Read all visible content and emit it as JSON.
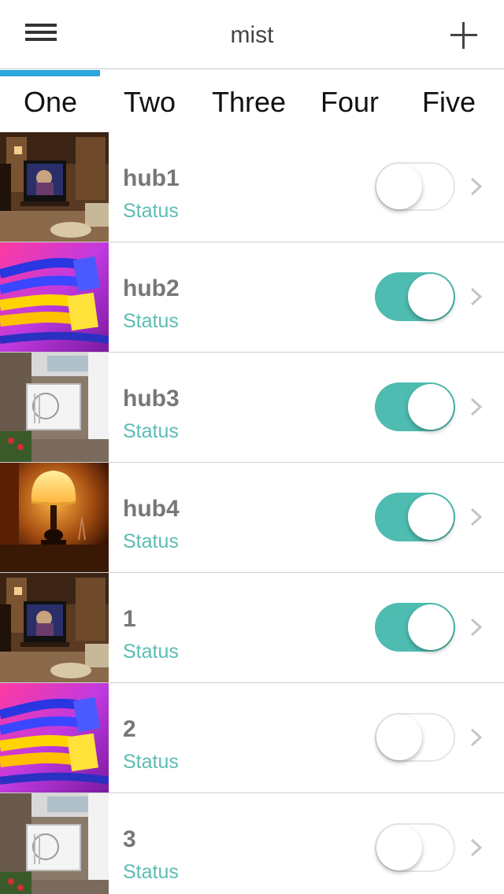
{
  "header": {
    "title": "mist",
    "menu_icon": "hamburger-menu-icon",
    "add_icon": "plus-icon"
  },
  "tabs": [
    {
      "label": "One",
      "selected": true
    },
    {
      "label": "Two",
      "selected": false
    },
    {
      "label": "Three",
      "selected": false
    },
    {
      "label": "Four",
      "selected": false
    },
    {
      "label": "Five",
      "selected": false
    }
  ],
  "colors": {
    "accent": "#2ca6dc",
    "toggle_on": "#4ebcb0",
    "status_text": "#5bbdb4",
    "name_text": "#777777"
  },
  "hubs": [
    {
      "name": "hub1",
      "status": "Status",
      "enabled": false,
      "thumbnail": "living-room-tv"
    },
    {
      "name": "hub2",
      "status": "Status",
      "enabled": true,
      "thumbnail": "network-cables"
    },
    {
      "name": "hub3",
      "status": "Status",
      "enabled": true,
      "thumbnail": "air-conditioner"
    },
    {
      "name": "hub4",
      "status": "Status",
      "enabled": true,
      "thumbnail": "table-lamp"
    },
    {
      "name": "1",
      "status": "Status",
      "enabled": true,
      "thumbnail": "living-room-tv"
    },
    {
      "name": "2",
      "status": "Status",
      "enabled": false,
      "thumbnail": "network-cables"
    },
    {
      "name": "3",
      "status": "Status",
      "enabled": false,
      "thumbnail": "air-conditioner"
    }
  ]
}
